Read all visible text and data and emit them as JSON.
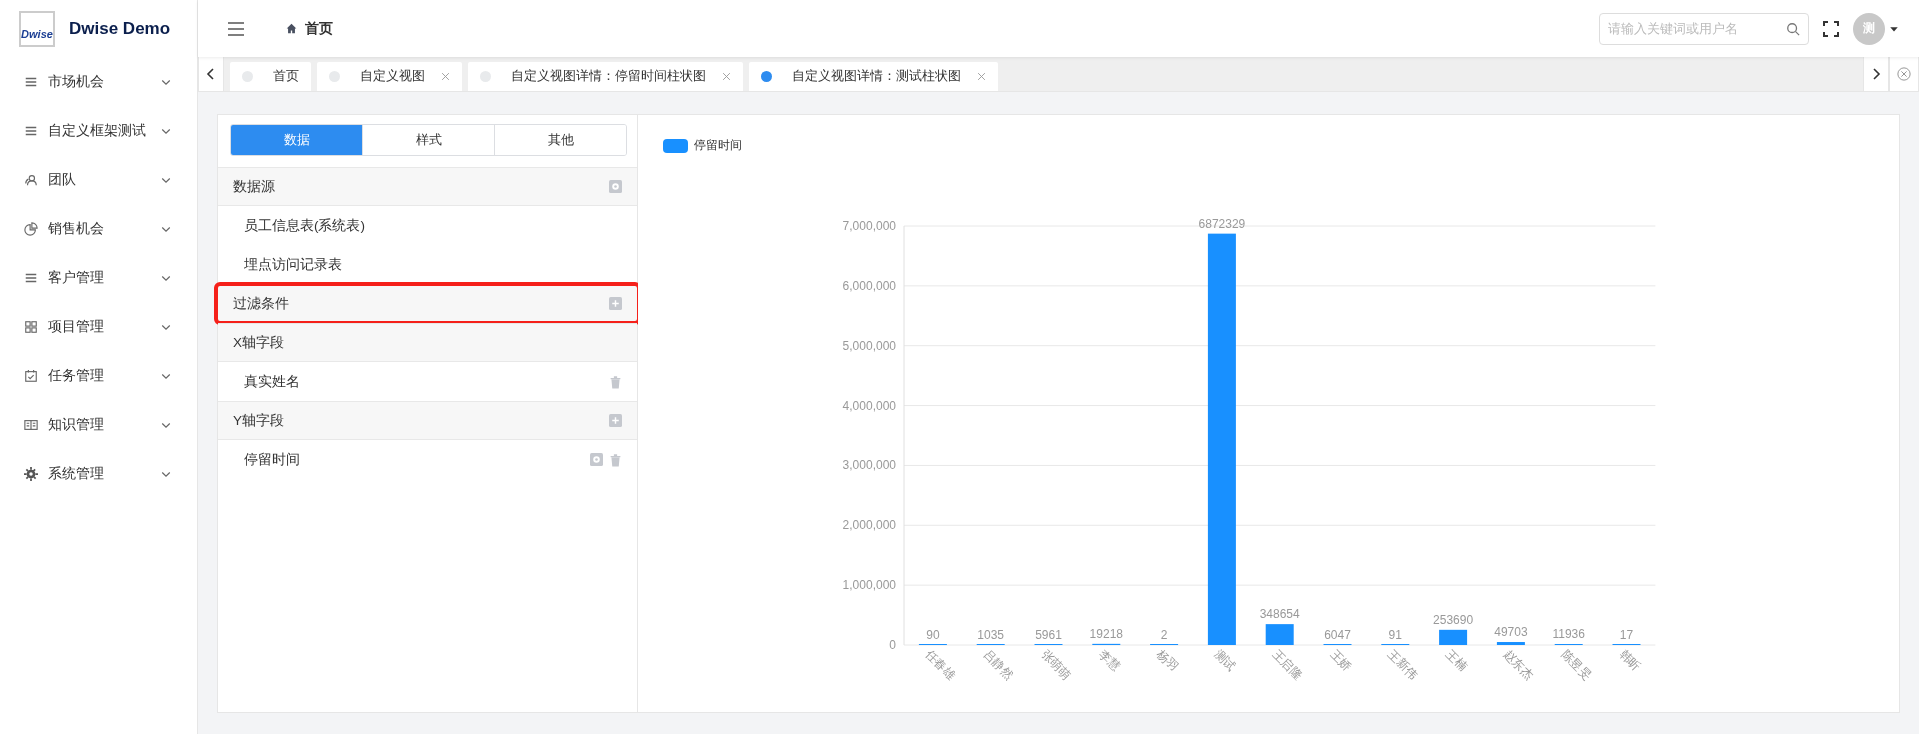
{
  "app": {
    "logo": "Dwise",
    "title": "Dwise Demo"
  },
  "sidebar": {
    "items": [
      {
        "label": "市场机会"
      },
      {
        "label": "自定义框架测试"
      },
      {
        "label": "团队"
      },
      {
        "label": "销售机会"
      },
      {
        "label": "客户管理"
      },
      {
        "label": "项目管理"
      },
      {
        "label": "任务管理"
      },
      {
        "label": "知识管理"
      },
      {
        "label": "系统管理"
      }
    ]
  },
  "header": {
    "breadcrumb": "首页",
    "search": {
      "placeholder": "请输入关键词或用户名"
    },
    "avatar": "测"
  },
  "tabs": [
    {
      "label": "首页",
      "selected": false,
      "closable": false
    },
    {
      "label": "自定义视图",
      "selected": false,
      "closable": true
    },
    {
      "label": "自定义视图详情：停留时间柱状图",
      "selected": false,
      "closable": true
    },
    {
      "label": "自定义视图详情：测试柱状图",
      "selected": true,
      "closable": true
    }
  ],
  "panel": {
    "segments": [
      {
        "label": "数据",
        "selected": true
      },
      {
        "label": "样式",
        "selected": false
      },
      {
        "label": "其他",
        "selected": false
      }
    ],
    "sections": [
      {
        "title": "数据源",
        "configurable": true,
        "addable": false,
        "highlighted": false,
        "items": [
          {
            "label": "员工信息表(系统表)",
            "configurable": false,
            "deletable": false
          },
          {
            "label": "埋点访问记录表",
            "configurable": false,
            "deletable": false
          }
        ]
      },
      {
        "title": "过滤条件",
        "configurable": false,
        "addable": true,
        "highlighted": true
      },
      {
        "title": "X轴字段",
        "configurable": false,
        "addable": false,
        "highlighted": false,
        "items": [
          {
            "label": "真实姓名",
            "configurable": false,
            "deletable": true
          }
        ]
      },
      {
        "title": "Y轴字段",
        "configurable": false,
        "addable": true,
        "highlighted": false,
        "items": [
          {
            "label": "停留时间",
            "configurable": true,
            "deletable": true
          }
        ]
      }
    ]
  },
  "chart": {
    "chart_data": {
      "type": "bar",
      "categories": [
        "任春雄",
        "吕静然",
        "张萌萌",
        "李慧",
        "杨羽",
        "测试",
        "王启隆",
        "王娇",
        "王新伟",
        "王楠",
        "赵东杰",
        "陈昱旻",
        "韩昕"
      ],
      "series": [
        {
          "name": "停留时间",
          "color": "#1890ff",
          "values": [
            90,
            1035,
            5961,
            19218,
            2,
            6872329,
            348654,
            6047,
            91,
            253690,
            49703,
            11936,
            17
          ]
        }
      ],
      "ylim": [
        0,
        7000000
      ],
      "yticks": [
        {
          "value": 0,
          "label": "0"
        },
        {
          "value": 1000000,
          "label": "1,000,000"
        },
        {
          "value": 2000000,
          "label": "2,000,000"
        },
        {
          "value": 3000000,
          "label": "3,000,000"
        },
        {
          "value": 4000000,
          "label": "4,000,000"
        },
        {
          "value": 5000000,
          "label": "5,000,000"
        },
        {
          "value": 6000000,
          "label": "6,000,000"
        },
        {
          "value": 7000000,
          "label": "7,000,000"
        }
      ],
      "grid": true,
      "data_labels": true
    }
  }
}
